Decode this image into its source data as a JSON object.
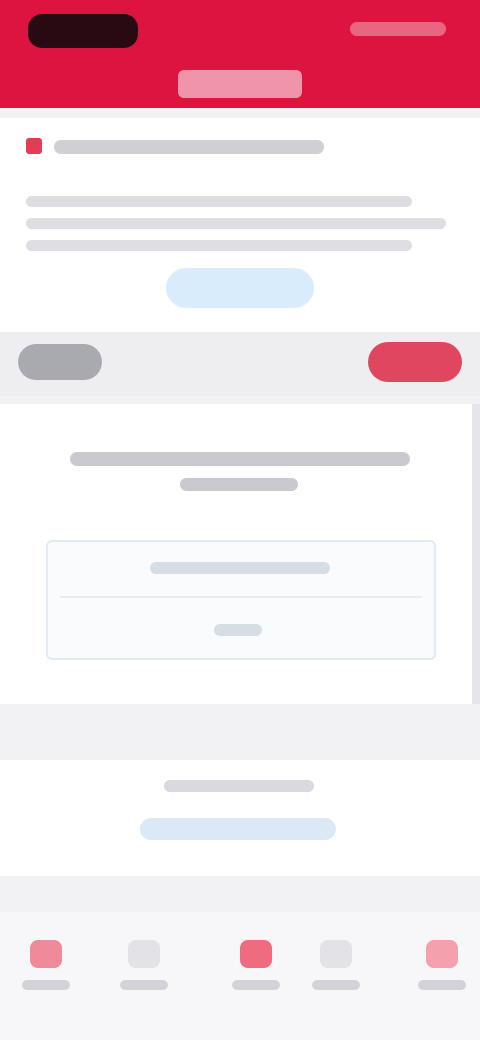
{
  "header": {
    "logo_label": "",
    "link_label": "",
    "title": ""
  },
  "notice": {
    "title": "",
    "description_lines": [
      "",
      "",
      ""
    ],
    "confirm_label": ""
  },
  "toggle": {
    "left_label": "",
    "right_label": ""
  },
  "question": {
    "line1": "",
    "line2": "",
    "option_a": "",
    "option_b": ""
  },
  "info": {
    "text": "",
    "link": ""
  },
  "nav": [
    {
      "label": "",
      "icon": "home-icon",
      "color": "#f08a9a"
    },
    {
      "label": "",
      "icon": "grid-icon",
      "color": "#e2e2e7"
    },
    {
      "label": "",
      "icon": "gift-icon",
      "color": "#f16b7f"
    },
    {
      "label": "",
      "icon": "chat-icon",
      "color": "#e2e2e7"
    },
    {
      "label": "",
      "icon": "user-icon",
      "color": "#f4a0ad"
    }
  ],
  "colors": {
    "brand": "#dd1440",
    "accent_light_blue": "#d9ecfb"
  }
}
